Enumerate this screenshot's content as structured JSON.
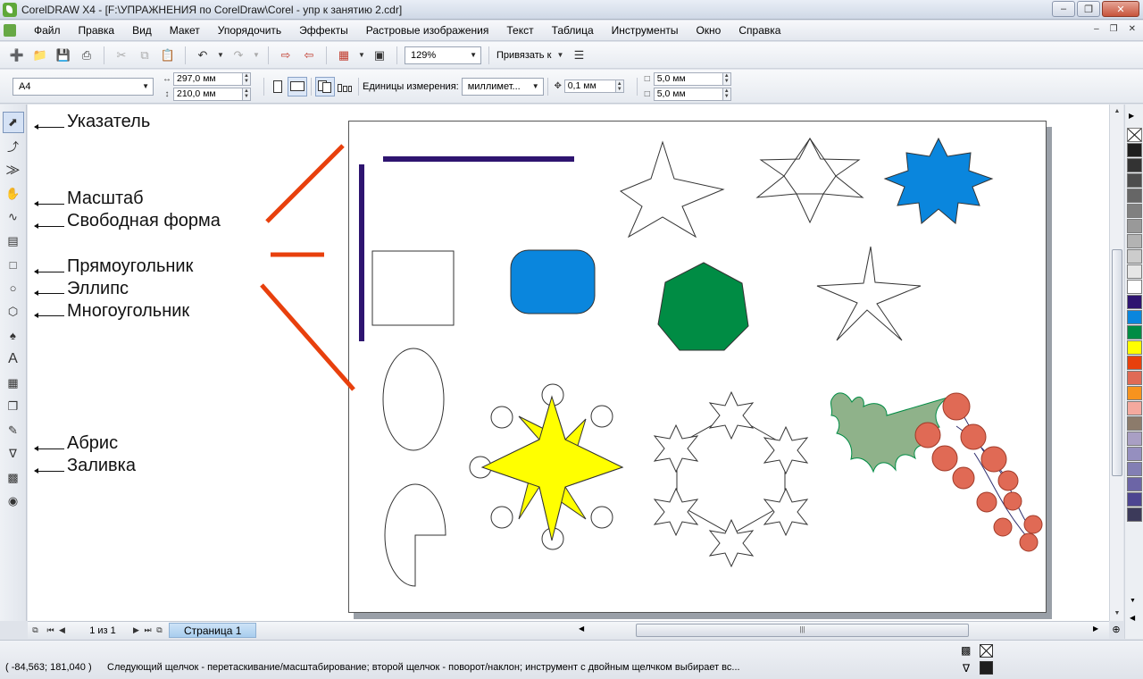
{
  "window": {
    "title": "CorelDRAW X4 - [F:\\УПРАЖНЕНИЯ по CorelDraw\\Corel - упр к занятию 2.cdr]"
  },
  "menu": [
    {
      "label": "Файл"
    },
    {
      "label": "Правка"
    },
    {
      "label": "Вид"
    },
    {
      "label": "Макет"
    },
    {
      "label": "Упорядочить"
    },
    {
      "label": "Эффекты"
    },
    {
      "label": "Растровые изображения"
    },
    {
      "label": "Текст"
    },
    {
      "label": "Таблица"
    },
    {
      "label": "Инструменты"
    },
    {
      "label": "Окно"
    },
    {
      "label": "Справка"
    }
  ],
  "toolbar": {
    "zoom": "129%",
    "snap_label": "Привязать к"
  },
  "property_bar": {
    "page_size": "A4",
    "width": "297,0 мм",
    "height": "210,0 мм",
    "units_label": "Единицы измерения:",
    "units_value": "миллимет...",
    "nudge": "0,1 мм",
    "dup_x": "5,0 мм",
    "dup_y": "5,0 мм"
  },
  "annotations": [
    {
      "text": "Указатель"
    },
    {
      "text": "Масштаб"
    },
    {
      "text": "Свободная форма"
    },
    {
      "text": "Прямоугольник"
    },
    {
      "text": "Эллипс"
    },
    {
      "text": "Многоугольник"
    },
    {
      "text": "Абрис"
    },
    {
      "text": "Заливка"
    }
  ],
  "colors": {
    "accent_red": "#e8400d",
    "line_purple": "#2e1470",
    "shape_blue": "#0a86dd",
    "shape_green": "#008c44",
    "star_yellow": "#ffff00",
    "leaf_green": "#8fb28a",
    "berry_red": "#e06a55"
  },
  "palette": [
    "none",
    "#1e1e1e",
    "#333333",
    "#4d4d4d",
    "#666666",
    "#808080",
    "#999999",
    "#b3b3b3",
    "#cccccc",
    "#e6e6e6",
    "#ffffff",
    "#2e1470",
    "#0a86dd",
    "#008c44",
    "#ffff00",
    "#e8400d",
    "#e06a55",
    "#f7931e",
    "#f4a99e",
    "#8c7b6b",
    "#a99fc4",
    "#958fbf",
    "#837fb4",
    "#6c65a6",
    "#4d4591",
    "#3c3a5a"
  ],
  "page_nav": {
    "counter": "1 из 1",
    "tab": "Страница 1"
  },
  "status": {
    "coords": "( -84,563; 181,040 )",
    "message": "Следующий щелчок - перетаскивание/масштабирование; второй щелчок - поворот/наклон; инструмент с двойным щелчком выбирает вс..."
  }
}
